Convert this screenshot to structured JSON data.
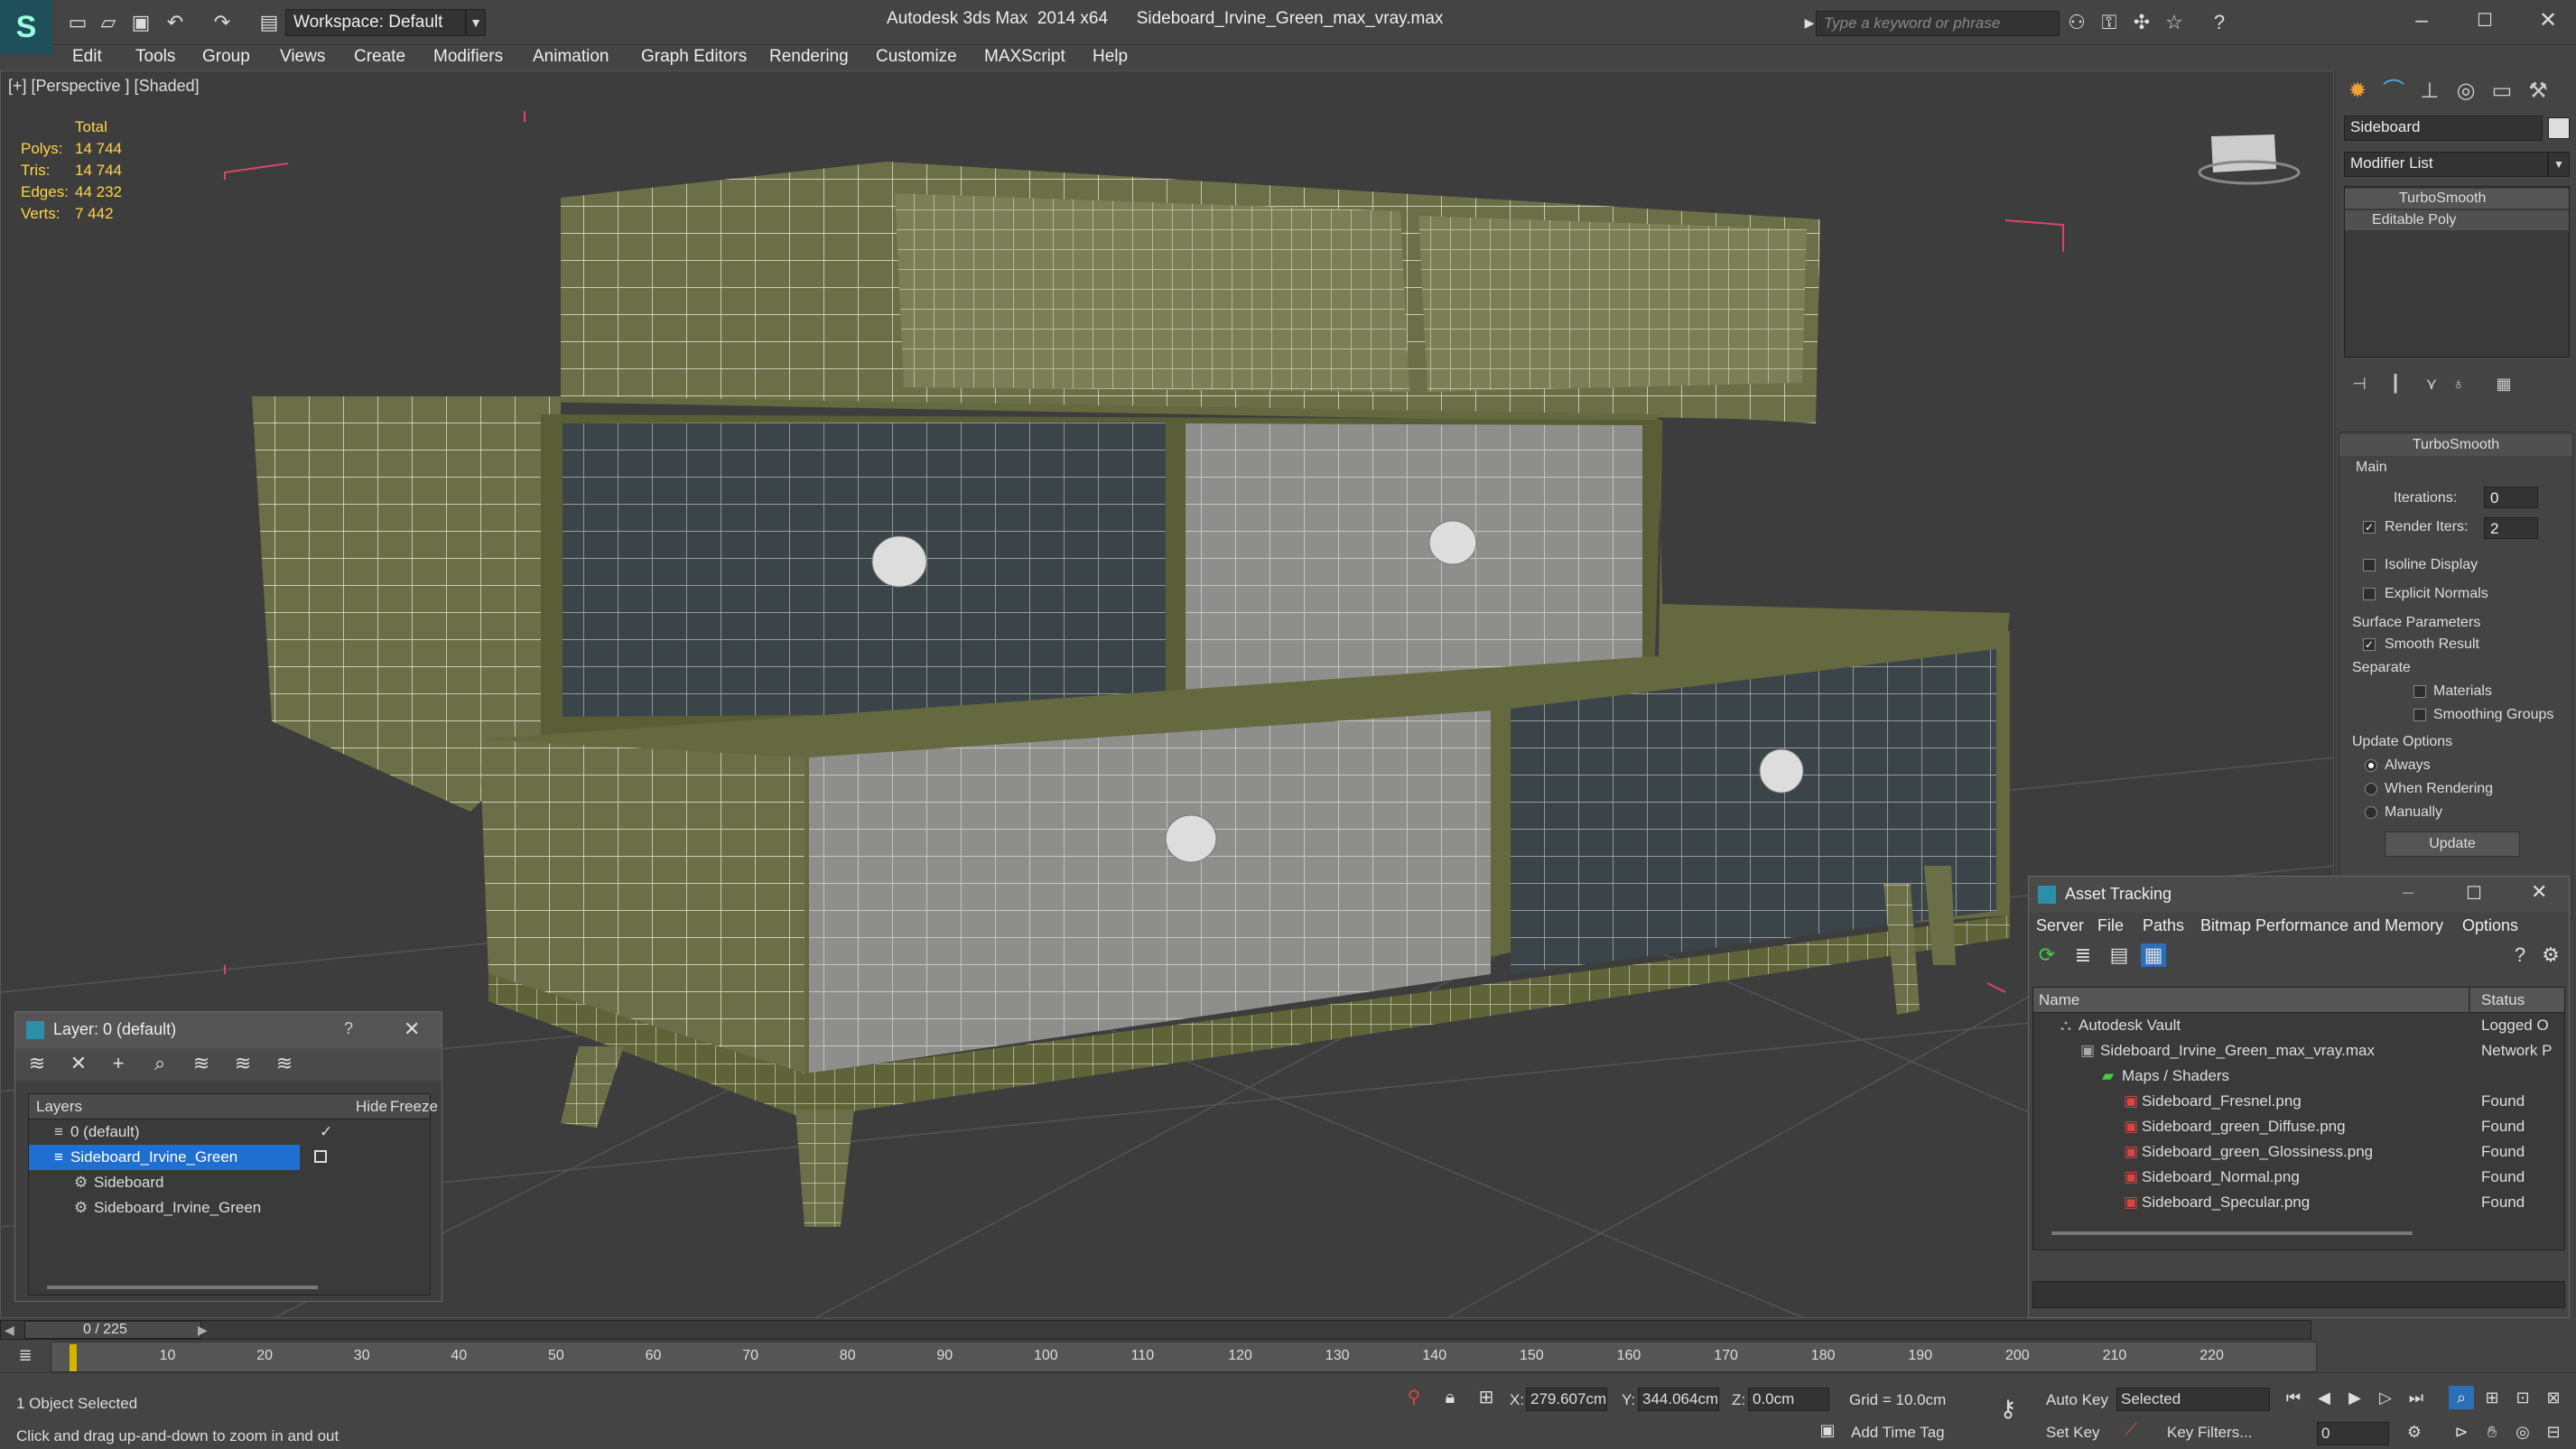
{
  "title_bar": {
    "workspace": "Workspace: Default",
    "app_title": "Autodesk 3ds Max  2014 x64      Sideboard_Irvine_Green_max_vray.max",
    "search_placeholder": "Type a keyword or phrase"
  },
  "menu": [
    "Edit",
    "Tools",
    "Group",
    "Views",
    "Create",
    "Modifiers",
    "Animation",
    "Graph Editors",
    "Rendering",
    "Customize",
    "MAXScript",
    "Help"
  ],
  "viewport": {
    "label": "[+] [Perspective ] [Shaded]",
    "stats": {
      "total_label": "Total",
      "polys_label": "Polys:",
      "polys": "14 744",
      "tris_label": "Tris:",
      "tris": "14 744",
      "edges_label": "Edges:",
      "edges": "44 232",
      "verts_label": "Verts:",
      "verts": "7 442"
    }
  },
  "command_panel": {
    "object_name": "Sideboard",
    "modifier_list": "Modifier List",
    "stack": [
      "TurboSmooth",
      "Editable Poly"
    ],
    "rollout_title": "TurboSmooth",
    "main_label": "Main",
    "iterations_label": "Iterations:",
    "iterations": "0",
    "render_iters_label": "Render Iters:",
    "render_iters": "2",
    "isoline": "Isoline Display",
    "explicit_normals": "Explicit Normals",
    "surface_params": "Surface Parameters",
    "smooth_result": "Smooth Result",
    "separate": "Separate",
    "materials": "Materials",
    "smoothing_groups": "Smoothing Groups",
    "update_options": "Update Options",
    "always": "Always",
    "when_rendering": "When Rendering",
    "manually": "Manually",
    "update_button": "Update"
  },
  "layer_dialog": {
    "title": "Layer: 0 (default)",
    "help": "?",
    "col_layers": "Layers",
    "col_hide": "Hide",
    "col_freeze": "Freeze",
    "rows": [
      "0 (default)",
      "Sideboard_Irvine_Green",
      "Sideboard",
      "Sideboard_Irvine_Green"
    ]
  },
  "asset_tracking": {
    "title": "Asset Tracking",
    "menu": [
      "Server",
      "File",
      "Paths",
      "Bitmap Performance and Memory",
      "Options"
    ],
    "col_name": "Name",
    "col_status": "Status",
    "rows": [
      {
        "name": "Autodesk Vault",
        "status": "Logged O"
      },
      {
        "name": "Sideboard_Irvine_Green_max_vray.max",
        "status": "Network P"
      },
      {
        "name": "Maps / Shaders",
        "status": ""
      },
      {
        "name": "Sideboard_Fresnel.png",
        "status": "Found"
      },
      {
        "name": "Sideboard_green_Diffuse.png",
        "status": "Found"
      },
      {
        "name": "Sideboard_green_Glossiness.png",
        "status": "Found"
      },
      {
        "name": "Sideboard_Normal.png",
        "status": "Found"
      },
      {
        "name": "Sideboard_Specular.png",
        "status": "Found"
      }
    ]
  },
  "timeline": {
    "frame": "0 / 225",
    "ticks": [
      "10",
      "20",
      "30",
      "40",
      "50",
      "60",
      "70",
      "80",
      "90",
      "100",
      "110",
      "120",
      "130",
      "140",
      "150",
      "160",
      "170",
      "180",
      "190",
      "200",
      "210",
      "220"
    ]
  },
  "status_bar": {
    "selection": "1 Object Selected",
    "prompt": "Click and drag up-and-down to zoom in and out",
    "x_label": "X:",
    "x": "279.607cm",
    "y_label": "Y:",
    "y": "344.064cm",
    "z_label": "Z:",
    "z": "0.0cm",
    "grid": "Grid = 10.0cm",
    "add_time_tag": "Add Time Tag",
    "auto_key": "Auto Key",
    "set_key": "Set Key",
    "selected": "Selected",
    "key_filters": "Key Filters...",
    "frame_field": "0"
  }
}
